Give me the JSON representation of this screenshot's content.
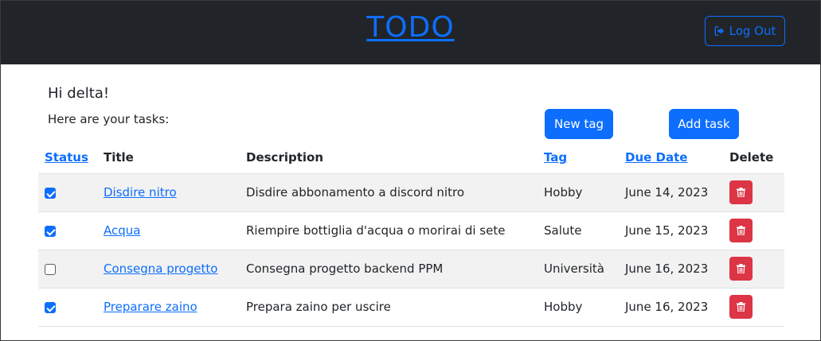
{
  "header": {
    "brand": "TODO",
    "logout_label": "Log Out"
  },
  "greeting": {
    "hello": "Hi delta!",
    "subtitle": "Here are your tasks:"
  },
  "actions": {
    "new_tag": "New tag",
    "add_task": "Add task"
  },
  "table": {
    "columns": {
      "status": "Status",
      "title": "Title",
      "description": "Description",
      "tag": "Tag",
      "due_date": "Due Date",
      "delete": "Delete"
    },
    "rows": [
      {
        "done": true,
        "title": "Disdire nitro",
        "description": "Disdire abbonamento a discord nitro",
        "tag": "Hobby",
        "due": "June 14, 2023"
      },
      {
        "done": true,
        "title": "Acqua",
        "description": "Riempire bottiglia d'acqua o morirai di sete",
        "tag": "Salute",
        "due": "June 15, 2023"
      },
      {
        "done": false,
        "title": "Consegna progetto",
        "description": "Consegna progetto backend PPM",
        "tag": "Università",
        "due": "June 16, 2023"
      },
      {
        "done": true,
        "title": "Preparare zaino",
        "description": "Prepara zaino per uscire",
        "tag": "Hobby",
        "due": "June 16, 2023"
      }
    ]
  },
  "colors": {
    "navbar": "#212529",
    "primary": "#0d6efd",
    "danger": "#dc3545",
    "stripe": "#f2f2f2"
  }
}
